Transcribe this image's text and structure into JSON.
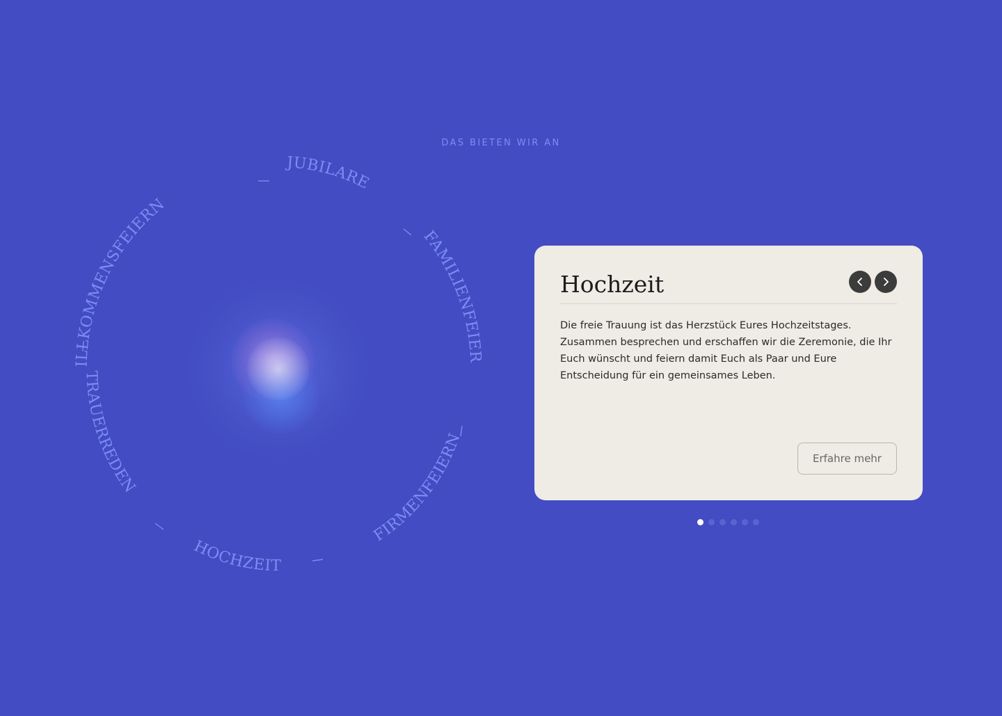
{
  "section": {
    "eyebrow": "DAS BIETEN WIR AN"
  },
  "ring": {
    "items": [
      {
        "label": "WILLKOMMENSFEIERN"
      },
      {
        "label": "JUBILARE"
      },
      {
        "label": "FAMILIENFEIERN"
      },
      {
        "label": "FIRMENFEIERN"
      },
      {
        "label": "HOCHZEIT"
      },
      {
        "label": "TRAUERREDEN"
      }
    ]
  },
  "card": {
    "title": "Hochzeit",
    "body": "Die freie Trauung ist das Herzstück Eures Hochzeitstages. Zusammen besprechen und erschaffen wir die Zeremonie, die Ihr Euch wünscht und feiern damit Euch als Paar und Eure Entscheidung für ein gemeinsames Leben.",
    "cta_label": "Erfahre mehr",
    "prev_icon": "chevron-left-icon",
    "next_icon": "chevron-right-icon"
  },
  "pagination": {
    "total": 6,
    "active_index": 0
  },
  "colors": {
    "background": "#434cc2",
    "accent_text": "#7d8cf3",
    "card_background": "#efece5",
    "nav_button": "#3c3c3c"
  }
}
